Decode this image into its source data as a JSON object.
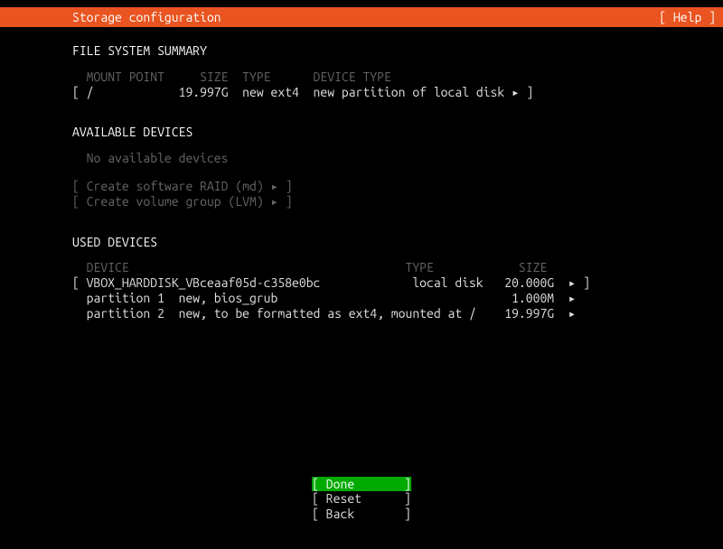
{
  "header": {
    "title": "Storage configuration",
    "help": "[ Help ]"
  },
  "fs_summary": {
    "title": "FILE SYSTEM SUMMARY",
    "columns": "  MOUNT POINT     SIZE  TYPE      DEVICE TYPE",
    "row": "[ /            19.997G  new ext4  new partition of local disk ▸ ]"
  },
  "available": {
    "title": "AVAILABLE DEVICES",
    "empty": "  No available devices",
    "raid": "[ Create software RAID (md) ▸ ]",
    "lvm": "[ Create volume group (LVM) ▸ ]"
  },
  "used": {
    "title": "USED DEVICES",
    "columns": "  DEVICE                                       TYPE            SIZE",
    "disk": "[ VBOX_HARDDISK_VBceaaf05d-c358e0bc             local disk   20.000G  ▸ ]",
    "part1": "  partition 1  new, bios_grub                                 1.000M  ▸",
    "part2": "  partition 2  new, to be formatted as ext4, mounted at /    19.997G  ▸"
  },
  "footer": {
    "done": "[ Done       ]",
    "reset": "[ Reset      ]",
    "back": "[ Back       ]"
  }
}
